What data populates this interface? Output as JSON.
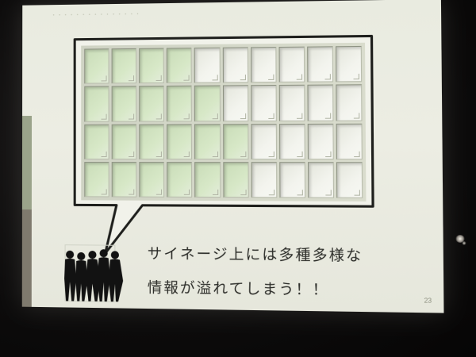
{
  "slide": {
    "header_text": "・・・・・・・・・・・・・・・",
    "caption_line_1": "サイネージ上には多種多様な",
    "caption_line_2": "情報が溢れてしまう！！",
    "page_number": "23"
  },
  "wall": {
    "rows": 4,
    "columns": 10,
    "green_columns_per_row": [
      4,
      5,
      6,
      6
    ]
  },
  "colors": {
    "slide_background": "#eaece1",
    "green_screen": "#d7e8c7",
    "plain_screen": "#f3f4ee",
    "text": "#2b2c28",
    "room": "#0c0b0b"
  },
  "icons": {
    "silhouette": "people-silhouette-icon",
    "speech_bubble": "speech-bubble-icon"
  }
}
